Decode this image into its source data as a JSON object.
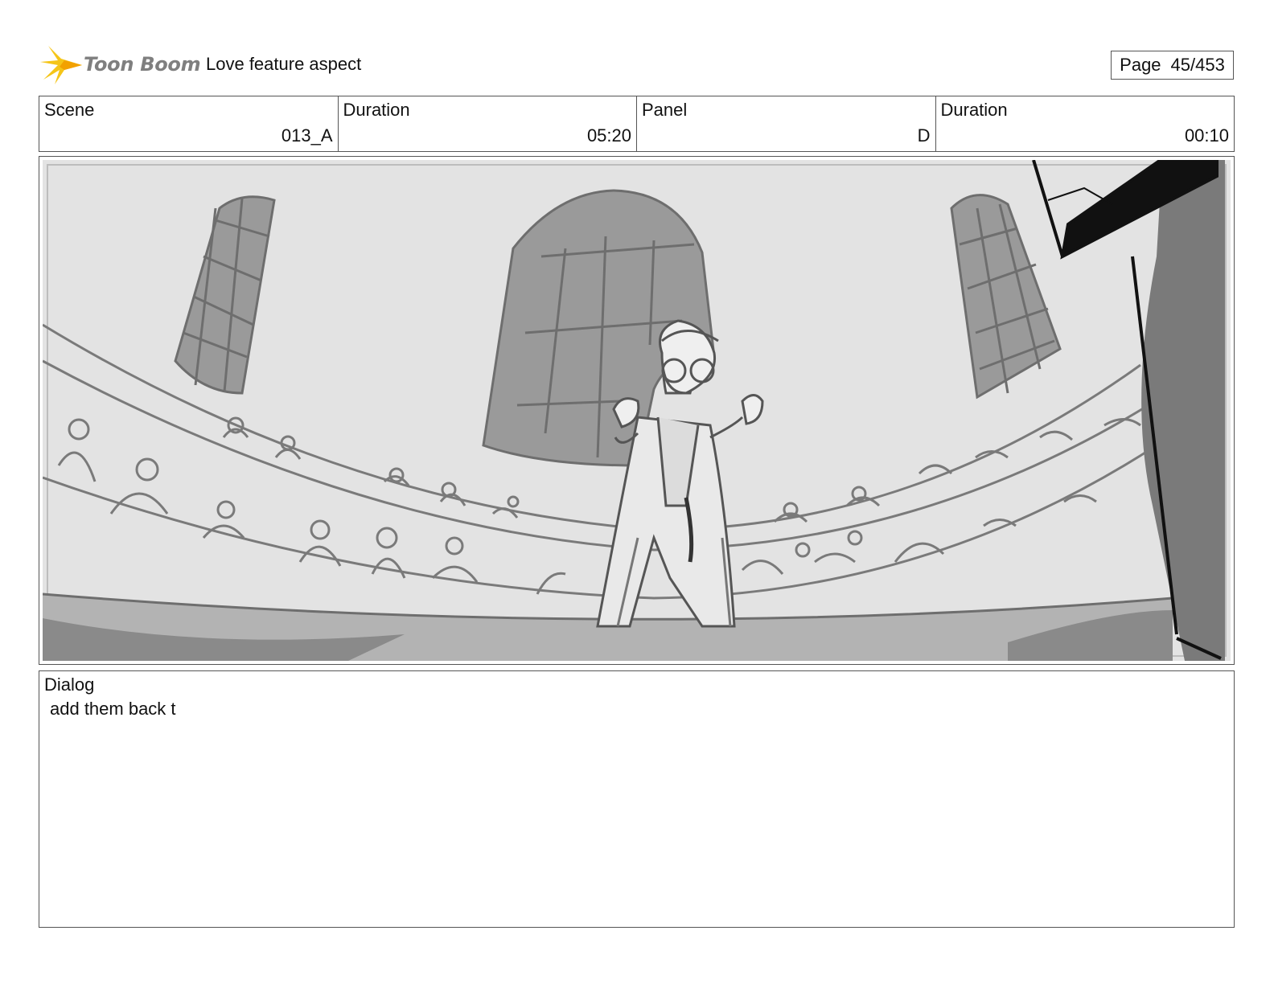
{
  "header": {
    "logo_text": "Toon Boom",
    "project_title": "Love feature aspect",
    "page_label": "Page",
    "page_number": "45/453"
  },
  "info": {
    "scene_label": "Scene",
    "scene_value": "013_A",
    "scene_duration_label": "Duration",
    "scene_duration_value": "05:20",
    "panel_label": "Panel",
    "panel_value": "D",
    "panel_duration_label": "Duration",
    "panel_duration_value": "00:10"
  },
  "dialog": {
    "label": "Dialog",
    "text": "add them back t"
  },
  "colors": {
    "logo_star": "#f5c518",
    "logo_text": "#7f7f7f",
    "sketch_light": "#e3e3e3",
    "sketch_mid": "#9a9a9a",
    "sketch_dark": "#6e6e6e"
  }
}
